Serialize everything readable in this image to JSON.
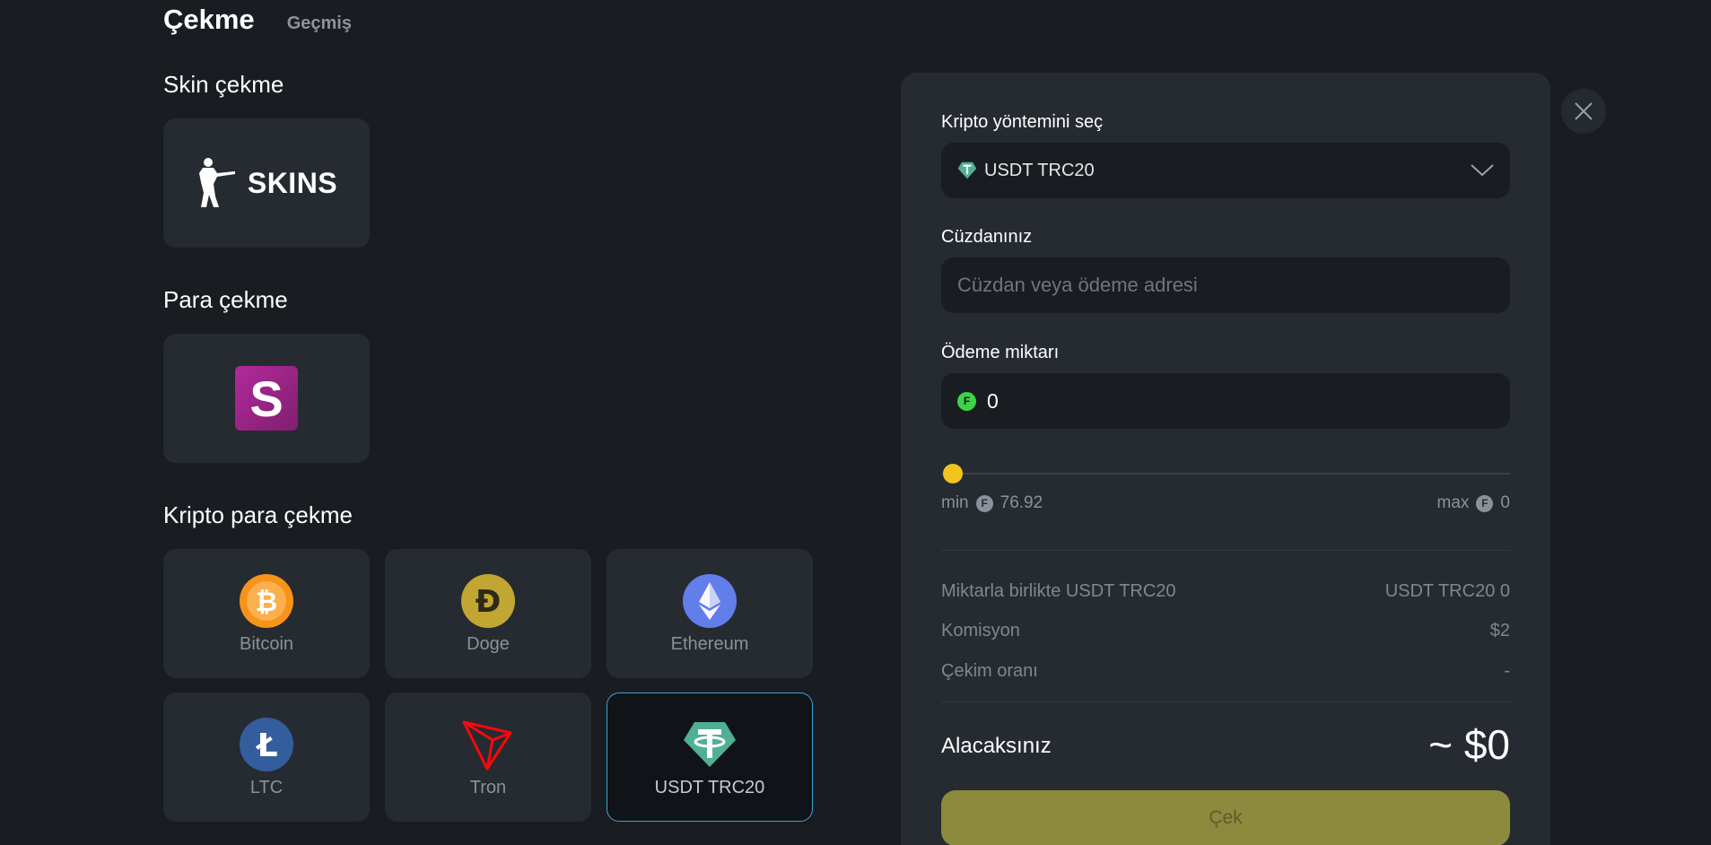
{
  "header": {
    "title": "Çekme",
    "history_tab": "Geçmiş"
  },
  "sections": {
    "skins": {
      "title": "Skin çekme",
      "card_label": "SKINS"
    },
    "fiat": {
      "title": "Para çekme",
      "card_label": "S"
    },
    "crypto": {
      "title": "Kripto para çekme",
      "coins": [
        {
          "label": "Bitcoin",
          "icon": "bitcoin-icon",
          "color": "#f7931a"
        },
        {
          "label": "Doge",
          "icon": "doge-icon",
          "color": "#c2a633"
        },
        {
          "label": "Ethereum",
          "icon": "ethereum-icon",
          "color": "#627eea"
        },
        {
          "label": "LTC",
          "icon": "litecoin-icon",
          "color": "#345d9d"
        },
        {
          "label": "Tron",
          "icon": "tron-icon",
          "color": "#ff060a"
        },
        {
          "label": "USDT TRC20",
          "icon": "tether-icon",
          "color": "#50af95",
          "selected": true
        }
      ]
    }
  },
  "panel": {
    "method_label": "Kripto yöntemini seç",
    "method_selected": "USDT TRC20",
    "wallet_label": "Cüzdanınız",
    "wallet_placeholder": "Cüzdan veya ödeme adresi",
    "amount_label": "Ödeme miktarı",
    "amount_value": "0",
    "slider": {
      "min_label": "min",
      "min_value": "76.92",
      "max_label": "max",
      "max_value": "0",
      "level": 0
    },
    "summary": [
      {
        "label": "Miktarla birlikte USDT TRC20",
        "value": "USDT TRC20 0"
      },
      {
        "label": "Komisyon",
        "value": "$2"
      },
      {
        "label": "Çekim oranı",
        "value": "-"
      }
    ],
    "receive_label": "Alacaksınız",
    "receive_value": "~ $0",
    "submit_label": "Çek"
  },
  "colors": {
    "accent_yellow": "#f2c31d",
    "selected_border": "#3aa3d6",
    "submit_bg": "#8c8a3c"
  }
}
